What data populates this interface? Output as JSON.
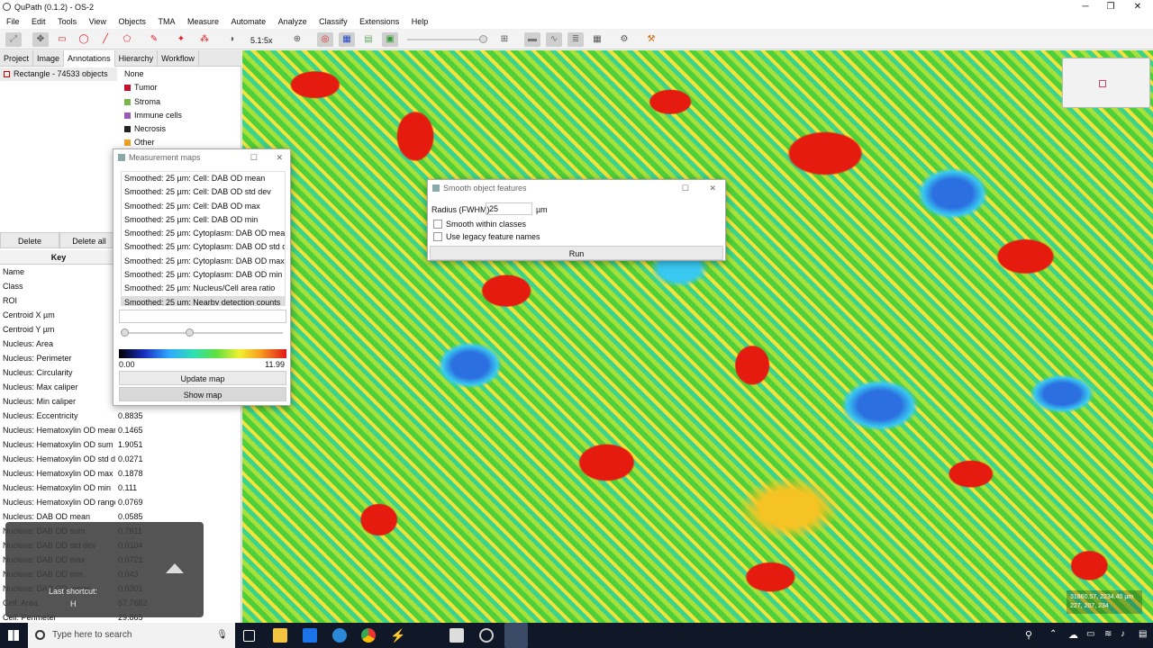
{
  "window": {
    "title": "QuPath (0.1.2) - OS-2",
    "minimize": "─",
    "maximize": "❐",
    "close": "✕"
  },
  "menu": [
    "File",
    "Edit",
    "Tools",
    "View",
    "Objects",
    "TMA",
    "Measure",
    "Automate",
    "Analyze",
    "Classify",
    "Extensions",
    "Help"
  ],
  "toolbar": {
    "zoom": "5.1:5x"
  },
  "tabs": [
    "Project",
    "Image",
    "Annotations",
    "Hierarchy",
    "Workflow"
  ],
  "annotation": {
    "label": "Rectangle - 74533 objects"
  },
  "classes": [
    {
      "name": "None",
      "color": ""
    },
    {
      "name": "Tumor",
      "color": "#c8102e"
    },
    {
      "name": "Stroma",
      "color": "#7ab648"
    },
    {
      "name": "Immune cells",
      "color": "#9b59b6"
    },
    {
      "name": "Necrosis",
      "color": "#222222"
    },
    {
      "name": "Other",
      "color": "#f0a020"
    }
  ],
  "buttons": {
    "delete": "Delete",
    "delete_all": "Delete all"
  },
  "table_header": "Key",
  "measurements": [
    {
      "k": "Name",
      "v": ""
    },
    {
      "k": "Class",
      "v": ""
    },
    {
      "k": "ROI",
      "v": ""
    },
    {
      "k": "Centroid X µm",
      "v": ""
    },
    {
      "k": "Centroid Y µm",
      "v": ""
    },
    {
      "k": "Nucleus: Area",
      "v": ""
    },
    {
      "k": "Nucleus: Perimeter",
      "v": ""
    },
    {
      "k": "Nucleus: Circularity",
      "v": ""
    },
    {
      "k": "Nucleus: Max caliper",
      "v": ""
    },
    {
      "k": "Nucleus: Min caliper",
      "v": ""
    },
    {
      "k": "Nucleus: Eccentricity",
      "v": "0.8835"
    },
    {
      "k": "Nucleus: Hematoxylin OD mean",
      "v": "0.1465"
    },
    {
      "k": "Nucleus: Hematoxylin OD sum",
      "v": "1.9051"
    },
    {
      "k": "Nucleus: Hematoxylin OD std dev",
      "v": "0.0271"
    },
    {
      "k": "Nucleus: Hematoxylin OD max",
      "v": "0.1878"
    },
    {
      "k": "Nucleus: Hematoxylin OD min",
      "v": "0.111"
    },
    {
      "k": "Nucleus: Hematoxylin OD range",
      "v": "0.0769"
    },
    {
      "k": "Nucleus: DAB OD mean",
      "v": "0.0585"
    },
    {
      "k": "Nucleus: DAB OD sum",
      "v": "0.7611"
    },
    {
      "k": "Nucleus: DAB OD std dev",
      "v": "0.0104"
    },
    {
      "k": "Nucleus: DAB OD max",
      "v": "0.0721"
    },
    {
      "k": "Nucleus: DAB OD min",
      "v": "0.043"
    },
    {
      "k": "Nucleus: DAB OD range",
      "v": "0.0301"
    },
    {
      "k": "Cell: Area",
      "v": "57.7682"
    },
    {
      "k": "Cell: Perimeter",
      "v": "29.865"
    }
  ],
  "measurement_maps": {
    "title": "Measurement maps",
    "items": [
      "Smoothed: 25 µm: Cell: DAB OD mean",
      "Smoothed: 25 µm: Cell: DAB OD std dev",
      "Smoothed: 25 µm: Cell: DAB OD max",
      "Smoothed: 25 µm: Cell: DAB OD min",
      "Smoothed: 25 µm: Cytoplasm: DAB OD mean",
      "Smoothed: 25 µm: Cytoplasm: DAB OD std dev",
      "Smoothed: 25 µm: Cytoplasm: DAB OD max",
      "Smoothed: 25 µm: Cytoplasm: DAB OD min",
      "Smoothed: 25 µm: Nucleus/Cell area ratio",
      "Smoothed: 25 µm: Nearby detection counts"
    ],
    "min_value": "0.00",
    "max_value": "11.99",
    "update_button": "Update map",
    "show_button": "Show map"
  },
  "smooth_dialog": {
    "title": "Smooth object features",
    "radius_label": "Radius (FWHM)",
    "radius_value": "25",
    "unit": "µm",
    "within_classes": "Smooth within classes",
    "legacy_names": "Use legacy feature names",
    "run": "Run"
  },
  "shortcut_overlay": {
    "label": "Last shortcut:",
    "key": "H"
  },
  "scalebar": {
    "line1": "31860.57, 2234.40 µm",
    "line2": "227, 207, 234"
  },
  "taskbar": {
    "search_placeholder": "Type here to search"
  }
}
